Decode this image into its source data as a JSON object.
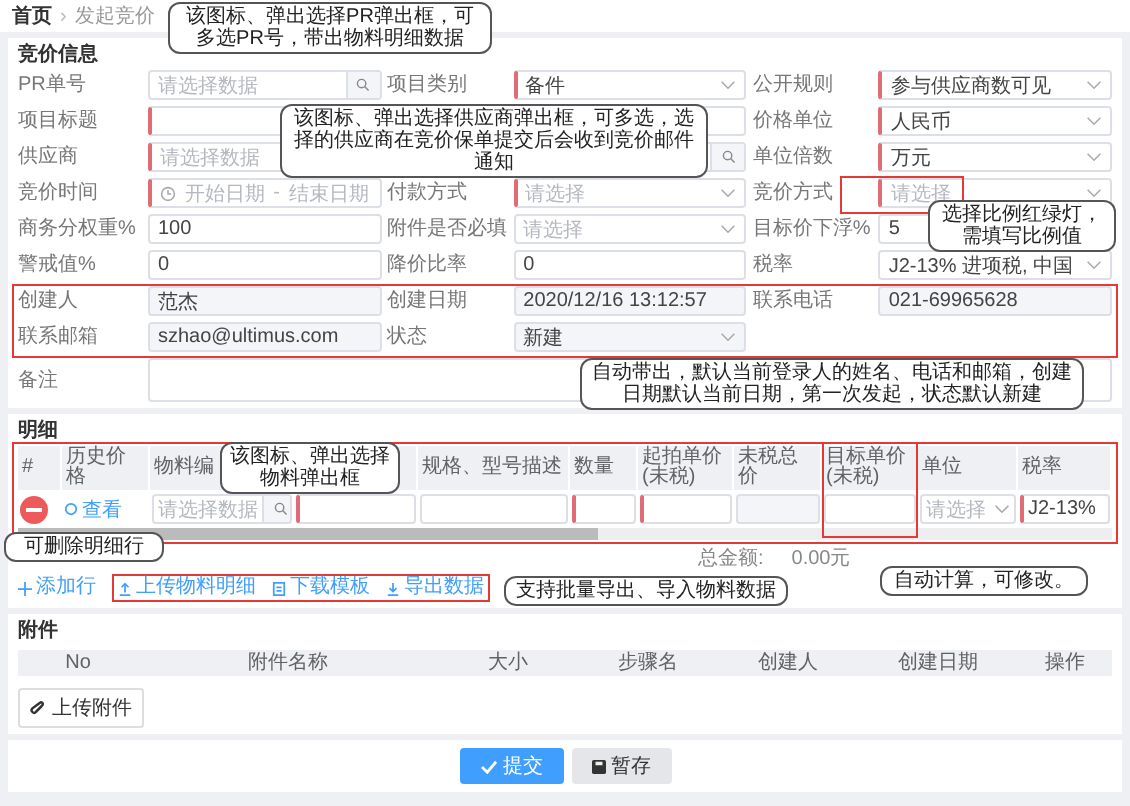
{
  "breadcrumb": {
    "separator": "›",
    "items": [
      {
        "label": "首页",
        "current": false
      },
      {
        "label": "发起竞价",
        "current": true
      }
    ]
  },
  "bid_info": {
    "title": "竞价信息",
    "rows": [
      [
        {
          "label": "PR单号",
          "kind": "search",
          "placeholder": "请选择数据",
          "required": false,
          "readonly": false
        },
        {
          "label": "项目类别",
          "kind": "select",
          "value": "备件",
          "required": true,
          "readonly": false
        },
        {
          "label": "公开规则",
          "kind": "select",
          "value": "参与供应商数可见",
          "required": true,
          "readonly": false
        }
      ],
      [
        {
          "label": "项目标题",
          "kind": "text",
          "required": true,
          "readonly": false,
          "wide": true
        },
        {
          "label": "价格单位",
          "kind": "select",
          "value": "人民币",
          "required": true,
          "readonly": false
        }
      ],
      [
        {
          "label": "供应商",
          "kind": "search",
          "placeholder": "请选择数据",
          "required": true,
          "readonly": false,
          "wide": true
        },
        {
          "label": "单位倍数",
          "kind": "select",
          "value": "万元",
          "required": true,
          "readonly": false
        }
      ],
      [
        {
          "label": "竞价时间",
          "kind": "daterange",
          "start_placeholder": "开始日期",
          "separator": "-",
          "end_placeholder": "结束日期",
          "required": true,
          "readonly": false
        },
        {
          "label": "付款方式",
          "kind": "select",
          "placeholder": "请选择",
          "required": true,
          "readonly": false
        },
        {
          "label": "竞价方式",
          "kind": "select",
          "placeholder": "请选择",
          "required": true,
          "readonly": false
        }
      ],
      [
        {
          "label": "商务分权重%",
          "kind": "text",
          "value": "100",
          "required": false,
          "readonly": false
        },
        {
          "label": "附件是否必填",
          "kind": "select",
          "placeholder": "请选择",
          "required": false,
          "readonly": false
        },
        {
          "label": "目标价下浮%",
          "kind": "text",
          "value": "5",
          "required": false,
          "readonly": false
        }
      ],
      [
        {
          "label": "警戒值%",
          "kind": "text",
          "value": "0",
          "required": false,
          "readonly": false
        },
        {
          "label": "降价比率",
          "kind": "text",
          "value": "0",
          "required": false,
          "readonly": false
        },
        {
          "label": "税率",
          "kind": "select",
          "value": "J2-13% 进项税, 中国",
          "required": false,
          "readonly": false
        }
      ],
      [
        {
          "label": "创建人",
          "kind": "text",
          "value": "范杰",
          "required": false,
          "readonly": true
        },
        {
          "label": "创建日期",
          "kind": "text",
          "value": "2020/12/16 13:12:57",
          "required": false,
          "readonly": true
        },
        {
          "label": "联系电话",
          "kind": "text",
          "value": "021-69965628",
          "required": false,
          "readonly": true
        }
      ],
      [
        {
          "label": "联系邮箱",
          "kind": "text",
          "value": "szhao@ultimus.com",
          "required": false,
          "readonly": true
        },
        {
          "label": "状态",
          "kind": "select",
          "value": "新建",
          "required": false,
          "readonly": true
        }
      ],
      [
        {
          "label": "备注",
          "kind": "textarea",
          "required": false,
          "readonly": false
        }
      ]
    ]
  },
  "detail": {
    "title": "明细",
    "columns": [
      {
        "label": "#"
      },
      {
        "label": "历史价格"
      },
      {
        "label": "物料编"
      },
      {},
      {
        "label": "规格、型号描述"
      },
      {
        "label": "数量"
      },
      {
        "label": "起拍单价(未税)"
      },
      {
        "label": "未税总价"
      },
      {
        "label": "目标单价(未税)"
      },
      {
        "label": "单位"
      },
      {
        "label": "税率"
      }
    ],
    "rows": [
      {
        "cells": [
          {
            "kind": "delete"
          },
          {
            "kind": "link",
            "value": "查看"
          },
          {
            "kind": "search",
            "placeholder": "请选择数据",
            "required": false,
            "readonly": false
          },
          {
            "kind": "input",
            "required": true,
            "readonly": false
          },
          {
            "kind": "input",
            "required": false,
            "readonly": false
          },
          {
            "kind": "input",
            "required": true,
            "readonly": false
          },
          {
            "kind": "input",
            "required": true,
            "readonly": false
          },
          {
            "kind": "input",
            "required": false,
            "readonly": true
          },
          {
            "kind": "input",
            "required": false,
            "readonly": false
          },
          {
            "kind": "select",
            "placeholder": "请选择",
            "required": false,
            "readonly": false
          },
          {
            "kind": "input",
            "value": "J2-13%",
            "required": true,
            "readonly": false
          }
        ]
      }
    ],
    "total_label": "总金额:",
    "total_value": "0.00元",
    "actions": [
      {
        "kind": "add",
        "label": "添加行"
      },
      {
        "kind": "upload",
        "label": "上传物料明细"
      },
      {
        "kind": "download",
        "label": "下载模板"
      },
      {
        "kind": "export",
        "label": "导出数据"
      }
    ]
  },
  "attachments": {
    "title": "附件",
    "columns": [
      "No",
      "附件名称",
      "大小",
      "步骤名",
      "创建人",
      "创建日期",
      "操作"
    ],
    "upload_button": "上传附件"
  },
  "footer_buttons": [
    {
      "label": "提交",
      "primary": true
    },
    {
      "label": "暂存",
      "primary": false
    }
  ],
  "annotations": [
    "该图标、弹出选择PR弹出框，可多选PR号，带出物料明细数据",
    "该图标、弹出选择供应商弹出框，可多选，选择的供应商在竞价保单提交后会收到竞价邮件通知",
    "选择比例红绿灯，需填写比例值",
    "自动带出，默认当前登录人的姓名、电话和邮箱，创建日期默认当前日期，第一次发起，状态默认新建",
    "该图标、弹出选择物料弹出框",
    "可删除明细行",
    "支持批量导出、导入物料数据",
    "自动计算，可修改。"
  ]
}
